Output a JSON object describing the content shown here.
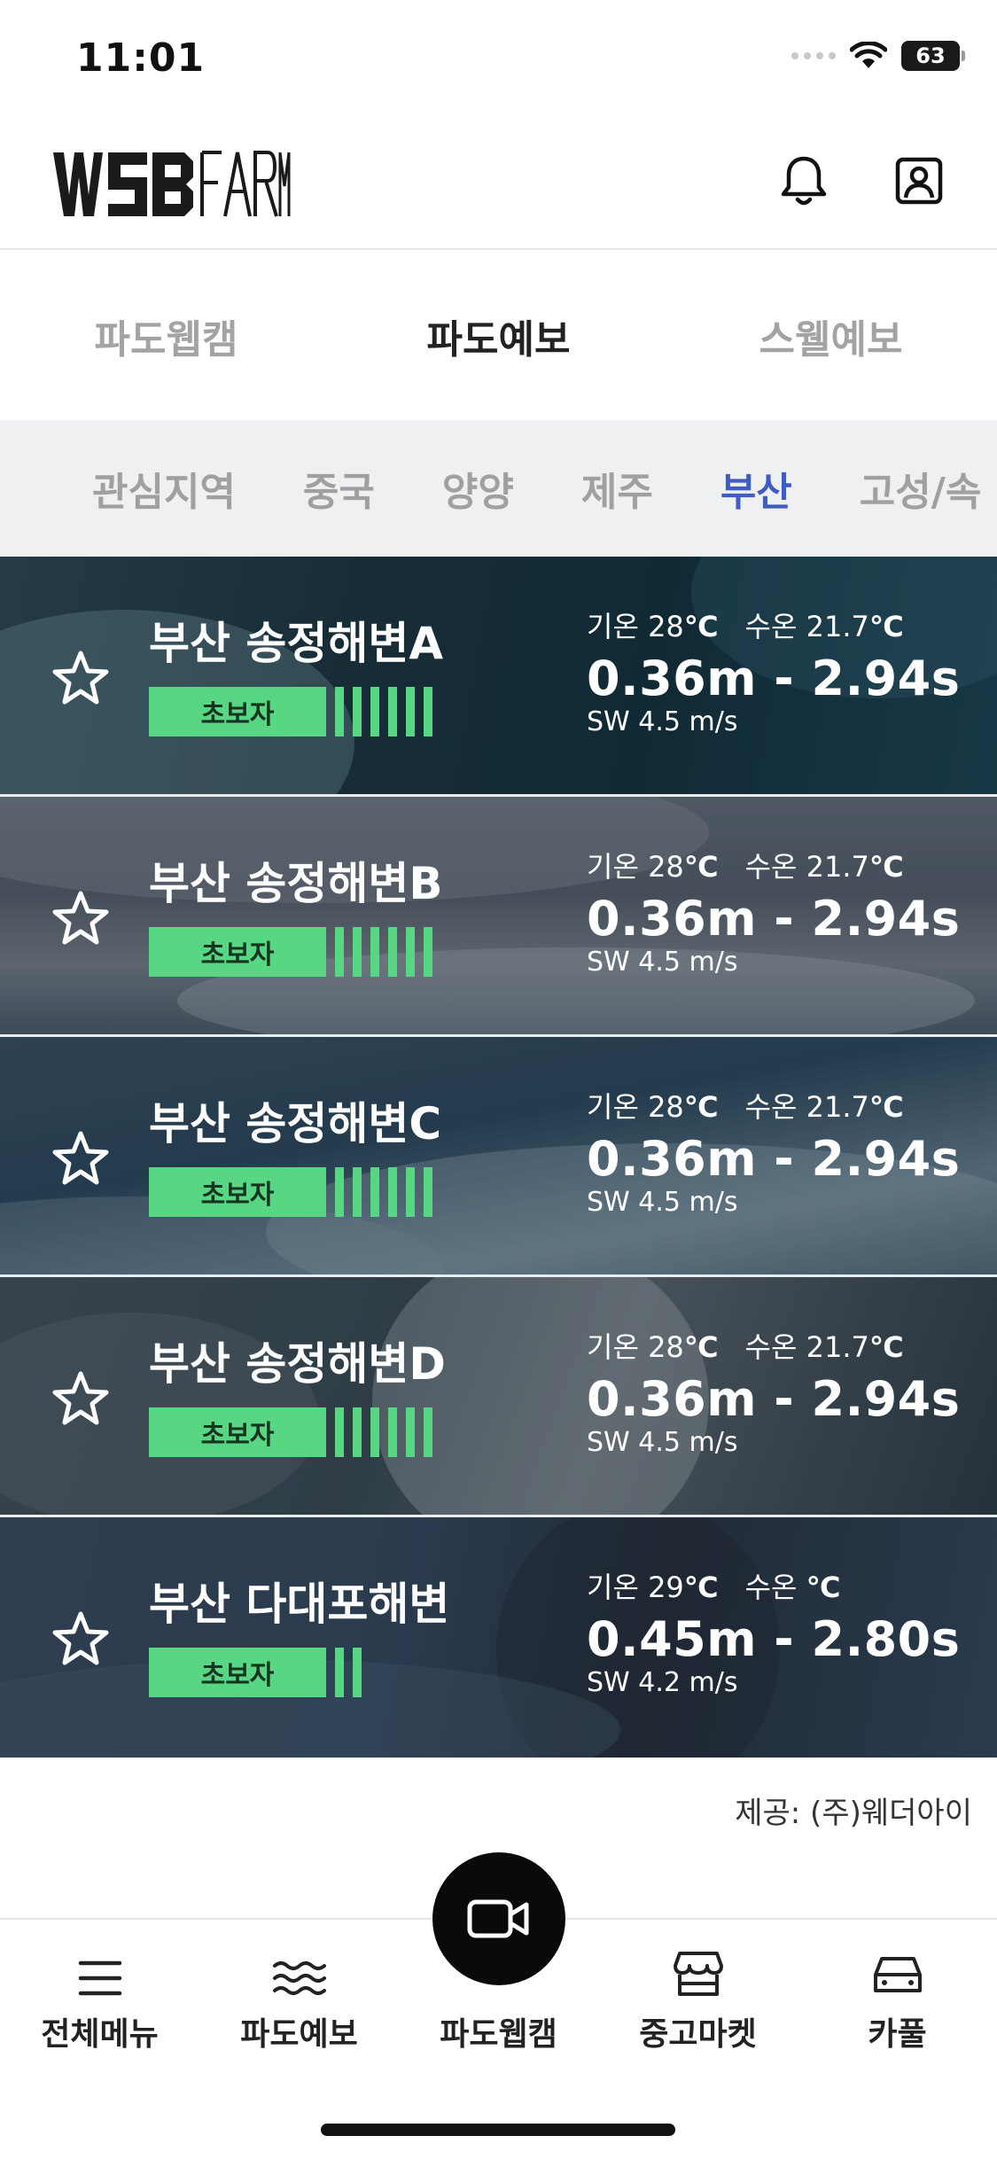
{
  "status_bar": {
    "time": "11:01",
    "battery": "63"
  },
  "header": {
    "logo_alt": "WSB FARM"
  },
  "main_tabs": [
    {
      "label": "파도웹캠",
      "active": false
    },
    {
      "label": "파도예보",
      "active": true
    },
    {
      "label": "스웰예보",
      "active": false
    }
  ],
  "region_tabs": [
    {
      "label": "관심지역",
      "active": false
    },
    {
      "label": "중국",
      "active": false
    },
    {
      "label": "양양",
      "active": false
    },
    {
      "label": "제주",
      "active": false
    },
    {
      "label": "부산",
      "active": true
    },
    {
      "label": "고성/속",
      "active": false
    }
  ],
  "beaches": [
    {
      "name": "부산 송정해변A",
      "level": "초보자",
      "level_bars": 6,
      "air_label": "기온",
      "air_temp": "28",
      "water_label": "수온",
      "water_temp": "21.7",
      "unit": "℃",
      "wave": "0.36m - 2.94s",
      "wind": "SW  4.5 m/s"
    },
    {
      "name": "부산 송정해변B",
      "level": "초보자",
      "level_bars": 6,
      "air_label": "기온",
      "air_temp": "28",
      "water_label": "수온",
      "water_temp": "21.7",
      "unit": "℃",
      "wave": "0.36m - 2.94s",
      "wind": "SW  4.5 m/s"
    },
    {
      "name": "부산 송정해변C",
      "level": "초보자",
      "level_bars": 6,
      "air_label": "기온",
      "air_temp": "28",
      "water_label": "수온",
      "water_temp": "21.7",
      "unit": "℃",
      "wave": "0.36m - 2.94s",
      "wind": "SW  4.5 m/s"
    },
    {
      "name": "부산 송정해변D",
      "level": "초보자",
      "level_bars": 6,
      "air_label": "기온",
      "air_temp": "28",
      "water_label": "수온",
      "water_temp": "21.7",
      "unit": "℃",
      "wave": "0.36m - 2.94s",
      "wind": "SW  4.5 m/s"
    },
    {
      "name": "부산 다대포해변",
      "level": "초보자",
      "level_bars": 2,
      "air_label": "기온",
      "air_temp": "29",
      "water_label": "수온",
      "water_temp": "",
      "unit": "℃",
      "wave": "0.45m - 2.80s",
      "wind": "SW  4.2 m/s"
    }
  ],
  "provider": "제공:  (주)웨더아이",
  "bottom_nav": [
    {
      "label": "전체메뉴",
      "icon": "menu-icon"
    },
    {
      "label": "파도예보",
      "icon": "waves-icon"
    },
    {
      "label": "파도웹캠",
      "icon": "video-camera-icon"
    },
    {
      "label": "중고마켓",
      "icon": "store-icon"
    },
    {
      "label": "카풀",
      "icon": "car-icon"
    }
  ],
  "colors": {
    "accent": "#3f5bc4",
    "level_green": "#57d684",
    "fab": "#0a0a0a"
  }
}
